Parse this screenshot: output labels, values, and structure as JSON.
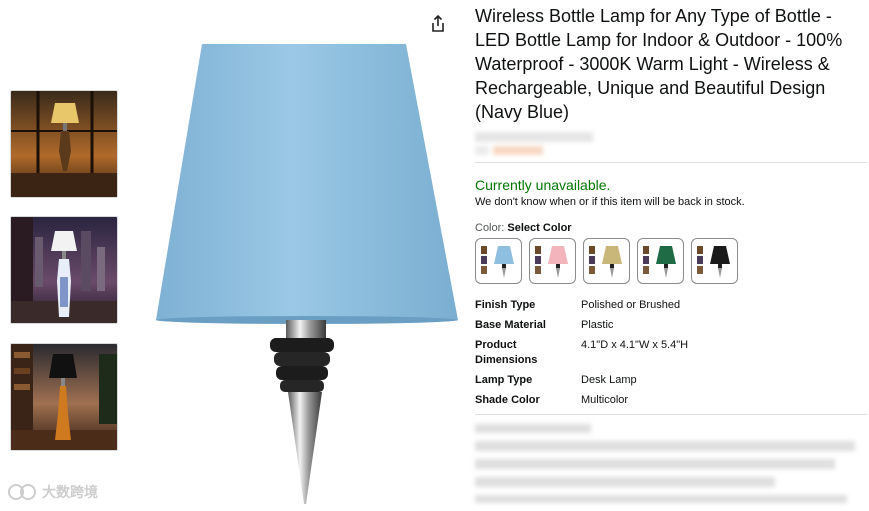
{
  "product": {
    "title": "Wireless Bottle Lamp for Any Type of Bottle - LED Bottle Lamp for Indoor & Outdoor - 100% Waterproof - 3000K Warm Light - Wireless & Rechargeable, Unique and Beautiful Design (Navy Blue)",
    "availability": "Currently unavailable.",
    "back_in_stock_note": "We don't know when or if this item will be back in stock.",
    "color_label": "Color:",
    "color_value": "Select Color",
    "main_shade_color": "#8fbfe0",
    "swatches": [
      {
        "color": "#8fbfe0"
      },
      {
        "color": "#f3b4bc"
      },
      {
        "color": "#c9b77a"
      },
      {
        "color": "#1f6b45"
      },
      {
        "color": "#1a1a1a"
      }
    ],
    "specs": [
      {
        "key": "Finish Type",
        "value": "Polished or Brushed"
      },
      {
        "key": "Base Material",
        "value": "Plastic"
      },
      {
        "key": "Product Dimensions",
        "value": "4.1\"D x 4.1\"W x 5.4\"H"
      },
      {
        "key": "Lamp Type",
        "value": "Desk Lamp"
      },
      {
        "key": "Shade Color",
        "value": "Multicolor"
      }
    ]
  },
  "icons": {
    "share": "share-icon"
  },
  "watermark": {
    "text": "大数跨境"
  }
}
